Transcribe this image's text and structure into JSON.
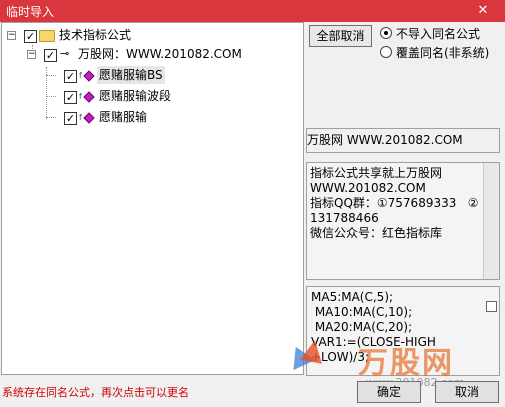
{
  "window": {
    "title": "临时导入",
    "close_glyph": "✕"
  },
  "tree": {
    "root": {
      "label": "技术指标公式",
      "expander": "−",
      "checked": "✓"
    },
    "group": {
      "label": "万股网：WWW.201082.COM",
      "expander": "−",
      "checked": "✓",
      "key_glyph": "⊸"
    },
    "items": [
      {
        "label": "愿赌服输BS",
        "checked": "✓",
        "fx": "f",
        "selected": true
      },
      {
        "label": "愿赌服输波段",
        "checked": "✓",
        "fx": "f",
        "selected": false
      },
      {
        "label": "愿赌服输",
        "checked": "✓",
        "fx": "f",
        "selected": false
      }
    ]
  },
  "options": {
    "deselect_all": "全部取消",
    "radio_skip": "不导入同名公式",
    "radio_overwrite": "覆盖同名(非系统)"
  },
  "info": {
    "source": "万股网 WWW.201082.COM",
    "description": "指标公式共享就上万股网\nWWW.201082.COM\n指标QQ群：①757689333   ②\n131788466\n微信公众号：红色指标库",
    "code": "MA5:MA(C,5);\n MA10:MA(C,10);\n MA20:MA(C,20);\nVAR1:=(CLOSE-HIGH\n+LOW)/3;"
  },
  "footer": {
    "status": "系统存在同名公式，再次点击可以更名",
    "ok": "确定",
    "cancel": "取消"
  },
  "watermark": {
    "brand": "万股网",
    "url": "www.201082.com"
  },
  "colors": {
    "titlebar": "#d9363e",
    "status": "#d00000"
  }
}
